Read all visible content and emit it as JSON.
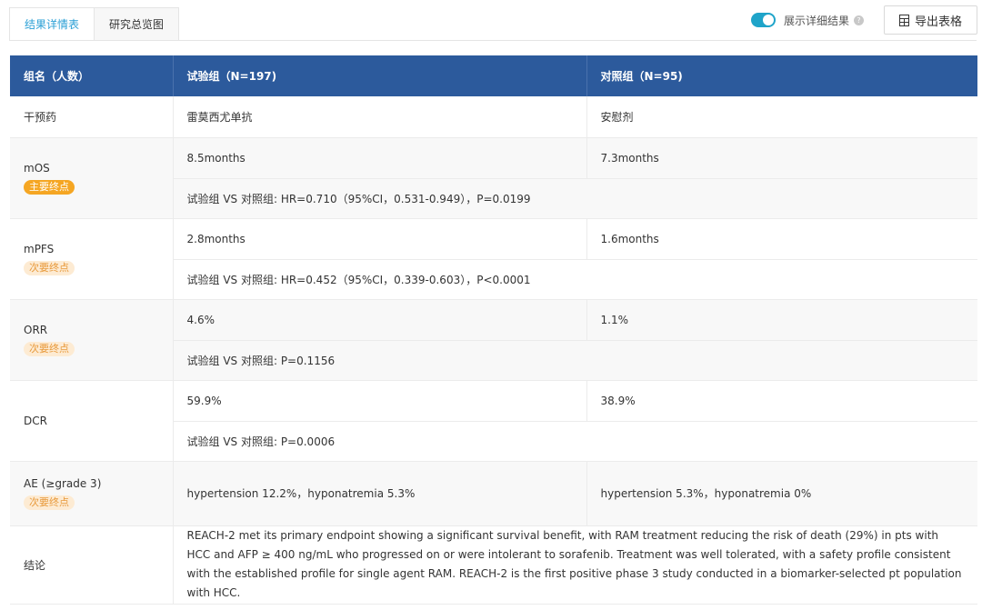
{
  "tabs": [
    {
      "label": "结果详情表",
      "active": true
    },
    {
      "label": "研究总览图",
      "active": false
    }
  ],
  "toggle": {
    "label": "展示详细结果",
    "on": true,
    "color": "#1fa4c9",
    "help_icon": "question-circle-icon"
  },
  "export": {
    "label": "导出表格",
    "icon": "export-table-icon"
  },
  "table": {
    "header_color": "#2c5a9c",
    "headers": [
      "组名（人数）",
      "试验组（N=197)",
      "对照组（N=95)"
    ],
    "intervention": {
      "name": "干预药",
      "trial": "雷莫西尤单抗",
      "control": "安慰剂"
    },
    "endpoints": [
      {
        "name": "mOS",
        "badge": "主要终点",
        "trial": "8.5months",
        "control": "7.3months",
        "compare": "试验组 VS 对照组: HR=0.710（95%CI，0.531-0.949），P=0.0199"
      },
      {
        "name": "mPFS",
        "badge": "次要终点",
        "trial": "2.8months",
        "control": "1.6months",
        "compare": "试验组 VS 对照组: HR=0.452（95%CI，0.339-0.603），P<0.0001"
      },
      {
        "name": "ORR",
        "badge": "次要终点",
        "trial": "4.6%",
        "control": "1.1%",
        "compare": "试验组 VS 对照组: P=0.1156"
      },
      {
        "name": "DCR",
        "badge": "",
        "trial": "59.9%",
        "control": "38.9%",
        "compare": "试验组 VS 对照组: P=0.0006"
      }
    ],
    "ae": {
      "name": "AE (≥grade 3)",
      "badge": "次要终点",
      "trial": "hypertension 12.2%，hyponatremia 5.3%",
      "control": "hypertension 5.3%，hyponatremia 0%"
    },
    "conclusion": {
      "name": "结论",
      "text": "REACH-2 met its primary endpoint showing a significant survival benefit, with RAM treatment reducing the risk of death (29%) in pts with HCC and AFP ≥ 400 ng/mL who progressed on or were intolerant to sorafenib. Treatment was well tolerated, with a safety profile consistent with the established profile for single agent RAM. REACH-2 is the first positive phase 3 study conducted in a biomarker-selected pt population with HCC."
    }
  }
}
